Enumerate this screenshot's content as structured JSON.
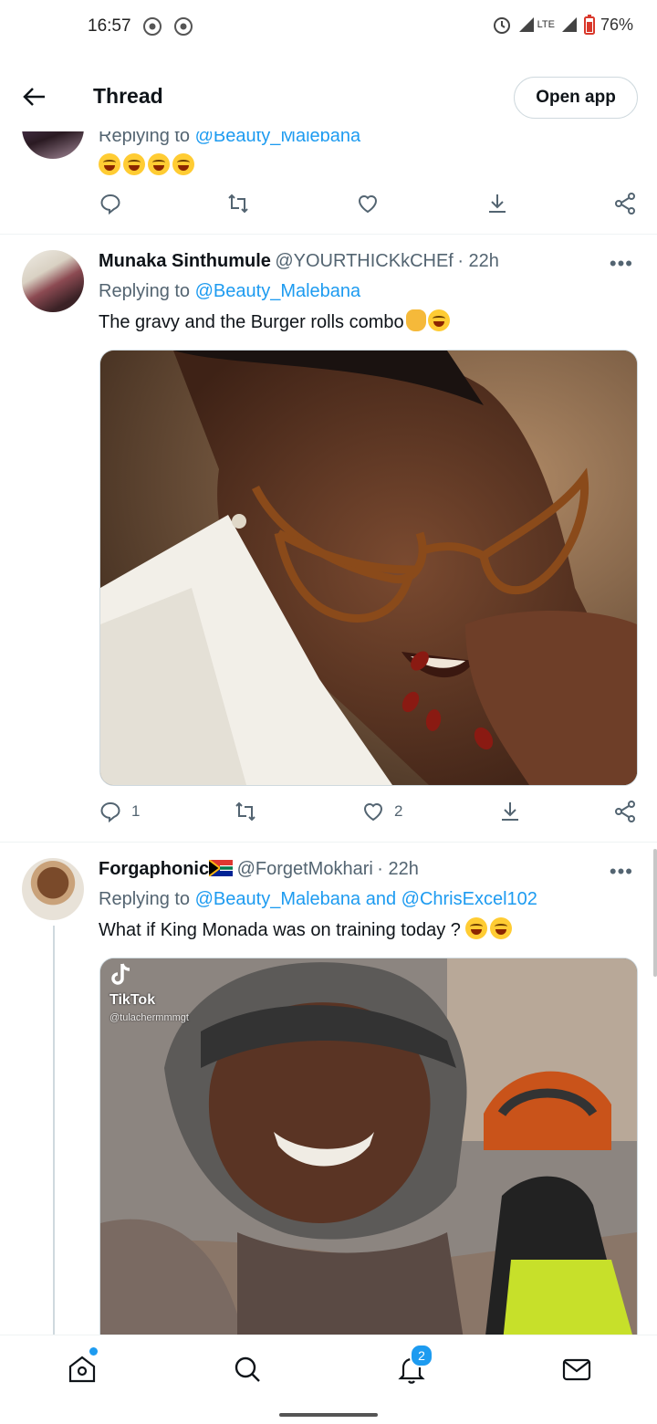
{
  "status": {
    "time": "16:57",
    "network": "LTE",
    "battery": "76%"
  },
  "header": {
    "title": "Thread",
    "open_app": "Open app"
  },
  "tweets": [
    {
      "reply_prefix": "Replying to",
      "reply_to": "@Beauty_Malebana",
      "text": ""
    },
    {
      "name": "Munaka Sinthumule",
      "handle": "@YOURTHICKkCHEf",
      "time": "· 22h",
      "reply_prefix": "Replying to",
      "reply_to": "@Beauty_Malebana",
      "text": "The gravy and the Burger rolls  combo",
      "replies": "1",
      "likes": "2"
    },
    {
      "name": "Forgaphonic",
      "handle": "@ForgetMokhari",
      "time": "· 22h",
      "reply_prefix": "Replying to",
      "reply_to": "@Beauty_Malebana and @ChrisExcel102",
      "text": "What if King Monada was on training today ? ",
      "media_watermark": "TikTok",
      "media_user": "@tulachermmmgt"
    }
  ],
  "nav": {
    "notifications_badge": "2"
  },
  "colors": {
    "accent": "#1d9bf0",
    "secondary_text": "#536471"
  }
}
